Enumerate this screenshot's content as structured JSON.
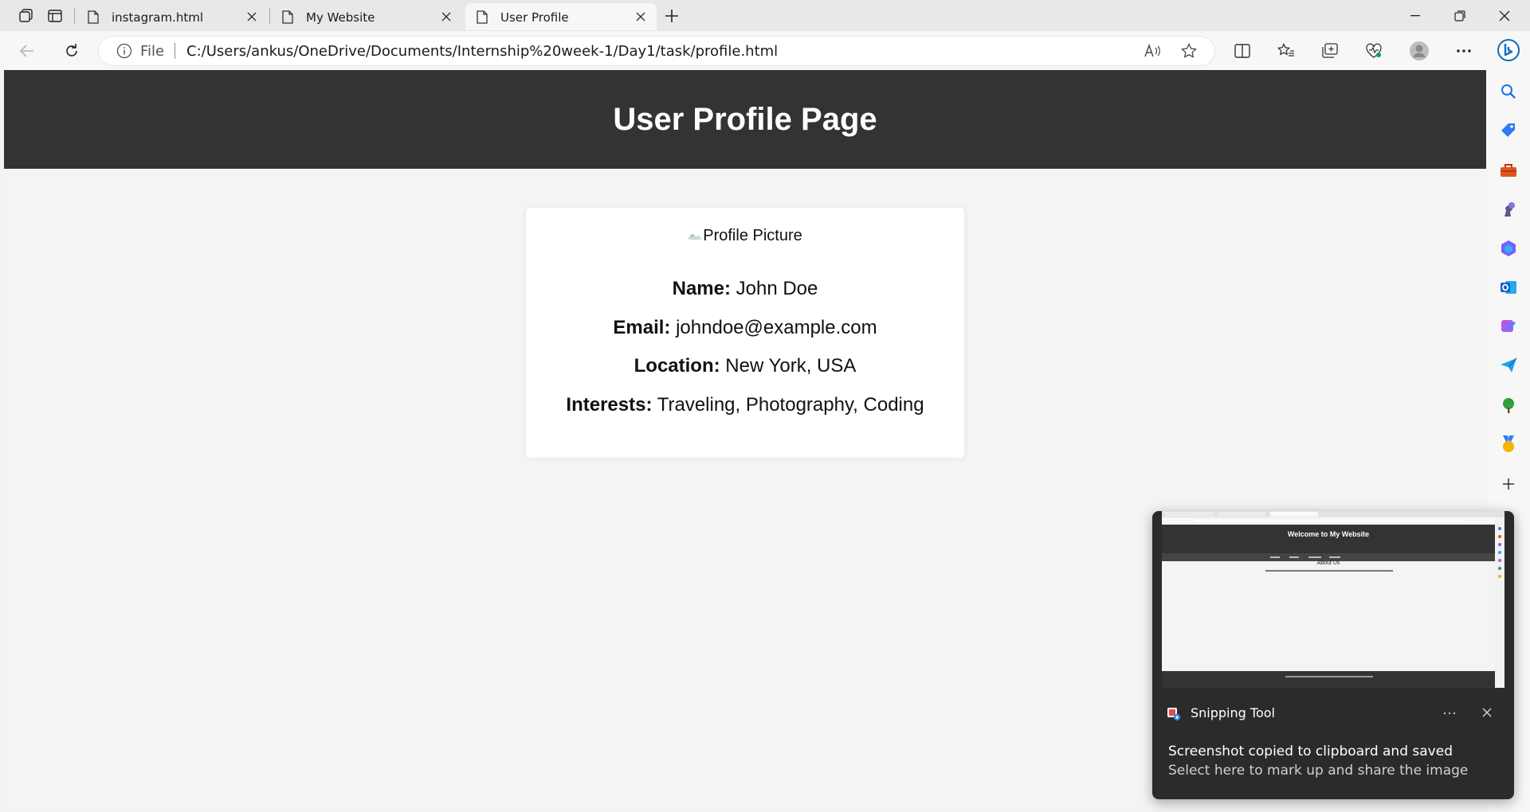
{
  "browser": {
    "tabs": [
      {
        "label": "instagram.html"
      },
      {
        "label": "My Website"
      },
      {
        "label": "User Profile"
      }
    ],
    "address": {
      "scheme_label": "File",
      "url": "C:/Users/ankus/OneDrive/Documents/Internship%20week-1/Day1/task/profile.html"
    }
  },
  "page": {
    "header_title": "User Profile Page",
    "profile": {
      "image_alt": "Profile Picture",
      "fields": [
        {
          "label": "Name:",
          "value": "John Doe"
        },
        {
          "label": "Email:",
          "value": "johndoe@example.com"
        },
        {
          "label": "Location:",
          "value": "New York, USA"
        },
        {
          "label": "Interests:",
          "value": "Traveling, Photography, Coding"
        }
      ]
    }
  },
  "notification": {
    "app_name": "Snipping Tool",
    "title": "Screenshot copied to clipboard and saved",
    "body": "Select here to mark up and share the image",
    "more_label": "···",
    "thumbnail": {
      "heading": "Welcome to My Website",
      "section_title": "About Us"
    }
  },
  "colors": {
    "header_bg": "#333333",
    "page_bg": "#f4f4f4",
    "card_bg": "#ffffff",
    "toast_bg": "#2b2b2b",
    "accent": "#0f6cbd"
  }
}
